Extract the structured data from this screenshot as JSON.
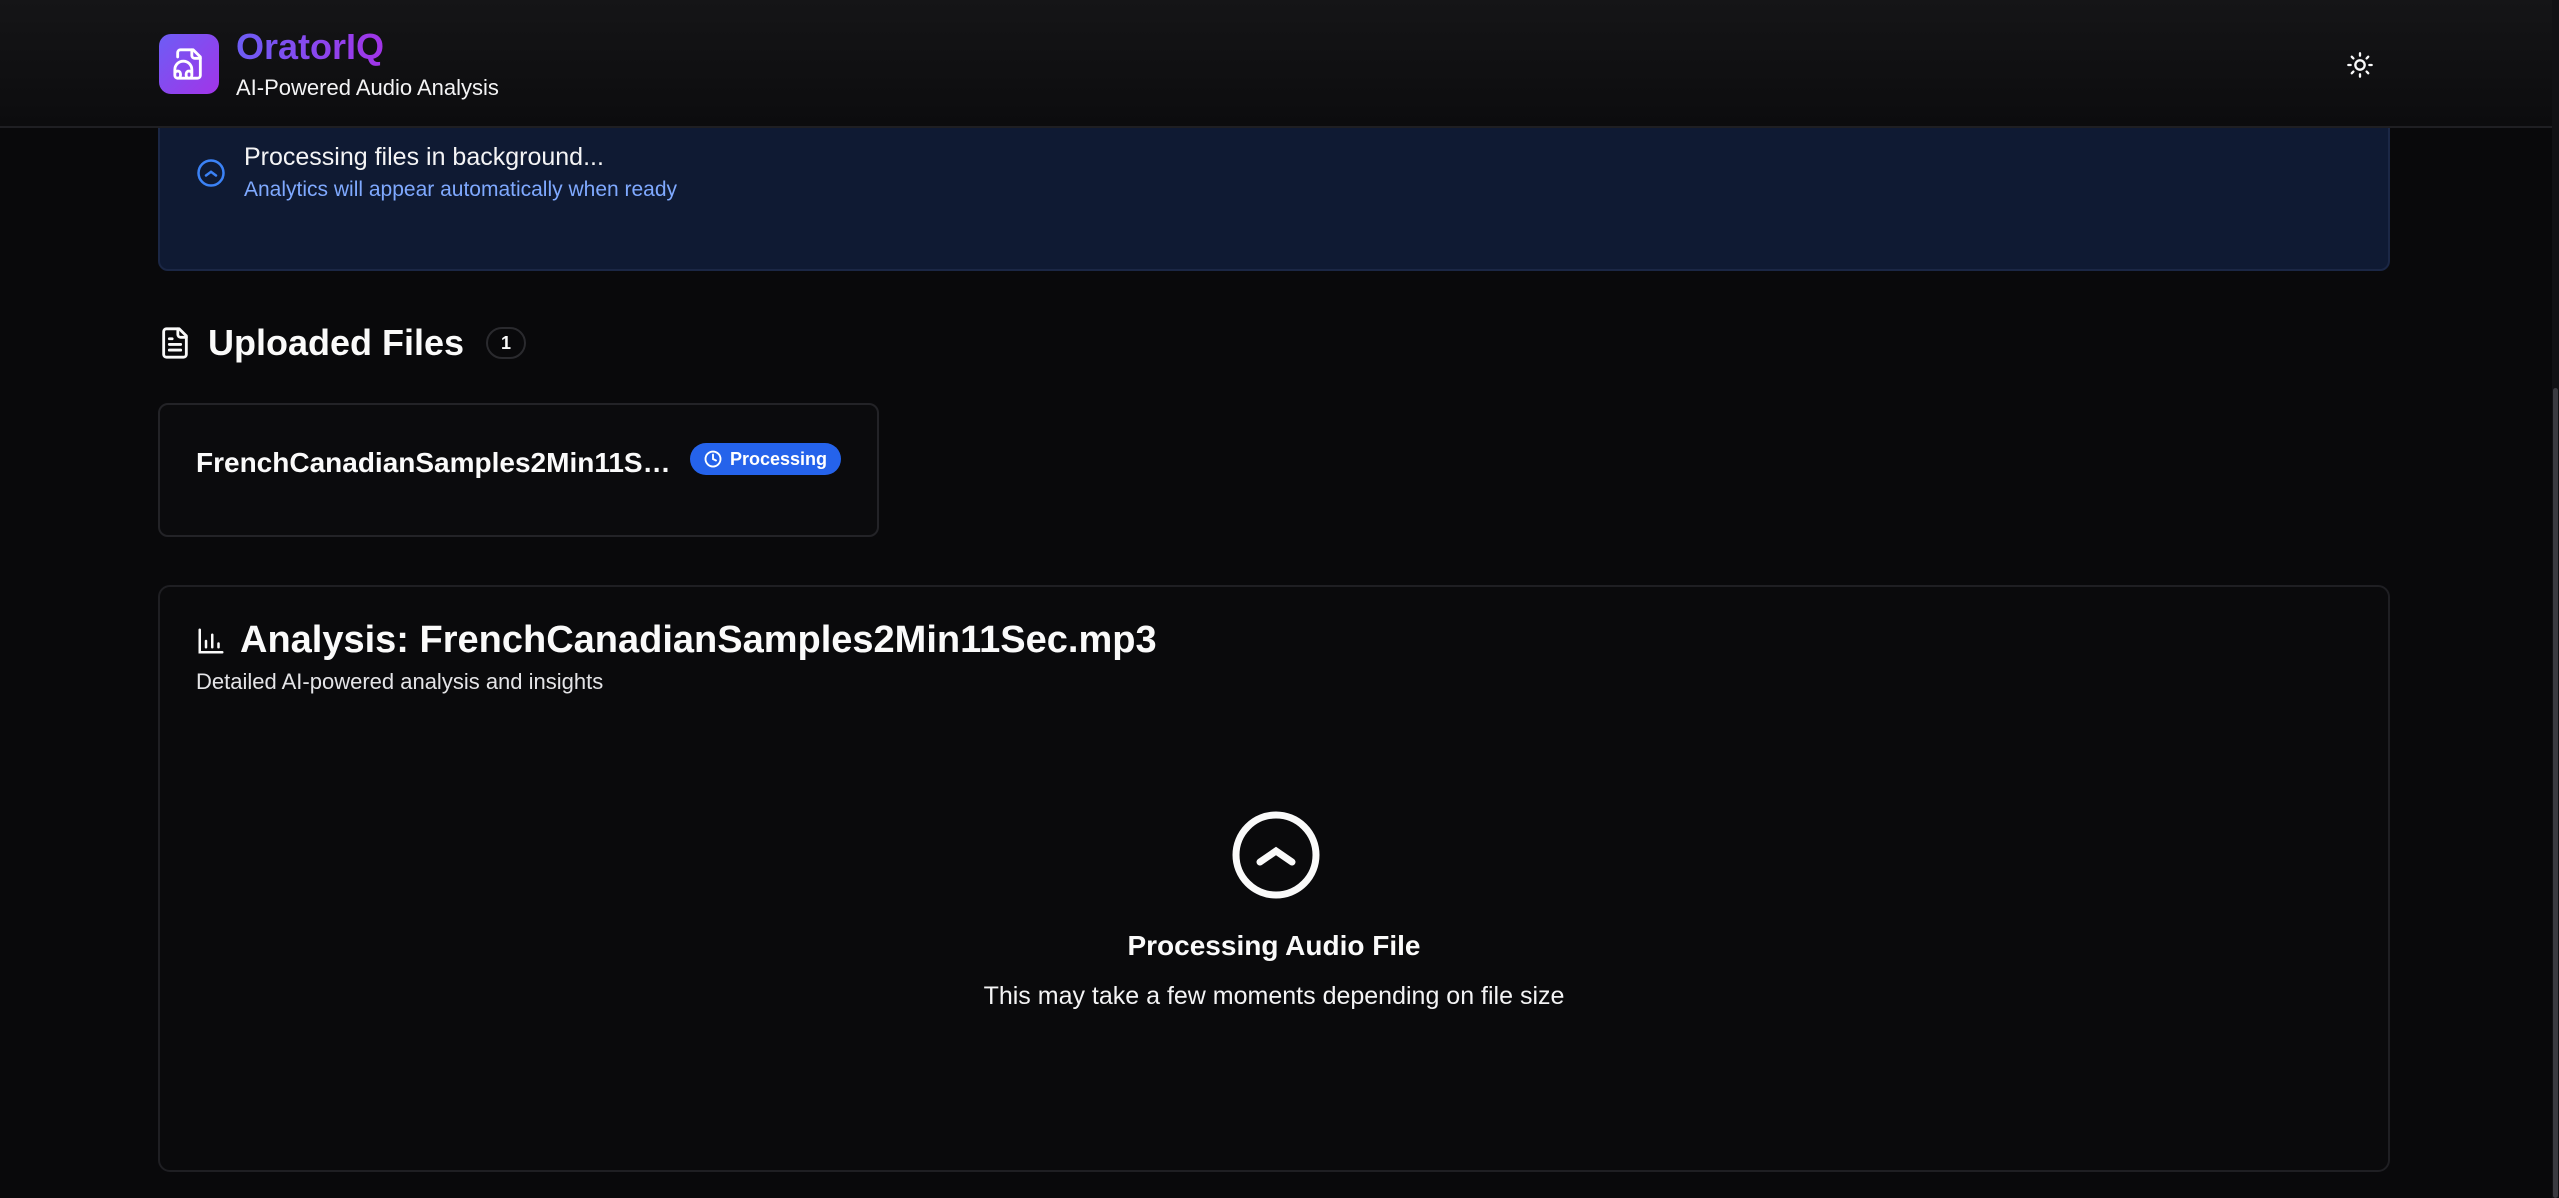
{
  "header": {
    "app_name": "OratorIQ",
    "tagline": "AI-Powered Audio Analysis",
    "logo_icon": "audio-file-headphones-icon",
    "theme_toggle_icon": "sun-icon"
  },
  "banner": {
    "title": "Processing files in background...",
    "subtitle": "Analytics will appear automatically when ready",
    "icon": "loader-icon"
  },
  "uploaded_files": {
    "title": "Uploaded Files",
    "count": "1",
    "icon": "file-text-icon",
    "files": [
      {
        "name": "FrenchCanadianSamples2Min11Sec.mp3",
        "status": "Processing",
        "status_icon": "clock-icon"
      }
    ]
  },
  "analysis": {
    "title": "Analysis: FrenchCanadianSamples2Min11Sec.mp3",
    "subtitle": "Detailed AI-powered analysis and insights",
    "icon": "bar-chart-icon",
    "processing_title": "Processing Audio File",
    "processing_subtitle": "This may take a few moments depending on file size",
    "processing_icon": "spinner-icon"
  },
  "colors": {
    "background": "#09090b",
    "brand_gradient_start": "#6d5df5",
    "brand_gradient_end": "#a234e8",
    "banner_bg": "#0f1a33",
    "banner_subtitle": "#7fa9ff",
    "status_badge": "#2563eb"
  }
}
